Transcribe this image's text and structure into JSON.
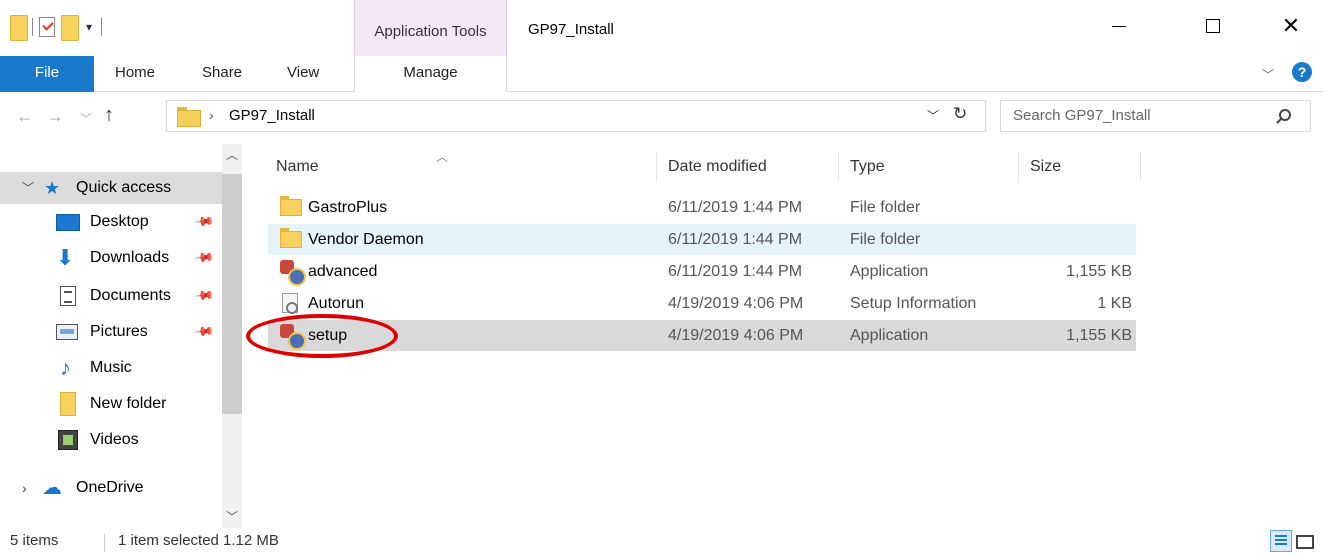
{
  "window": {
    "title": "GP97_Install",
    "context_tab_group": "Application Tools",
    "minimize_glyph": "—",
    "close_glyph": "✕"
  },
  "ribbon": {
    "tabs": {
      "file": "File",
      "home": "Home",
      "share": "Share",
      "view": "View",
      "manage": "Manage"
    }
  },
  "address": {
    "path": "GP97_Install",
    "search_placeholder": "Search GP97_Install"
  },
  "nav": {
    "quick_access": "Quick access",
    "items": [
      {
        "label": "Desktop",
        "pinned": true
      },
      {
        "label": "Downloads",
        "pinned": true
      },
      {
        "label": "Documents",
        "pinned": true
      },
      {
        "label": "Pictures",
        "pinned": true
      },
      {
        "label": "Music",
        "pinned": false
      },
      {
        "label": "New folder",
        "pinned": false
      },
      {
        "label": "Videos",
        "pinned": false
      }
    ],
    "onedrive": "OneDrive"
  },
  "columns": {
    "name": "Name",
    "date": "Date modified",
    "type": "Type",
    "size": "Size"
  },
  "files": [
    {
      "name": "GastroPlus",
      "date": "6/11/2019 1:44 PM",
      "type": "File folder",
      "size": "",
      "icon": "folder-icon"
    },
    {
      "name": "Vendor Daemon",
      "date": "6/11/2019 1:44 PM",
      "type": "File folder",
      "size": "",
      "icon": "folder-icon"
    },
    {
      "name": "advanced",
      "date": "6/11/2019 1:44 PM",
      "type": "Application",
      "size": "1,155 KB",
      "icon": "application-icon"
    },
    {
      "name": "Autorun",
      "date": "4/19/2019 4:06 PM",
      "type": "Setup Information",
      "size": "1 KB",
      "icon": "setup-info-icon"
    },
    {
      "name": "setup",
      "date": "4/19/2019 4:06 PM",
      "type": "Application",
      "size": "1,155 KB",
      "icon": "application-icon"
    }
  ],
  "status": {
    "count": "5 items",
    "selection": "1 item selected 1.12 MB"
  },
  "colors": {
    "accent": "#1979ca",
    "context_tab": "#f4e8f8",
    "annotation": "#e00000"
  }
}
